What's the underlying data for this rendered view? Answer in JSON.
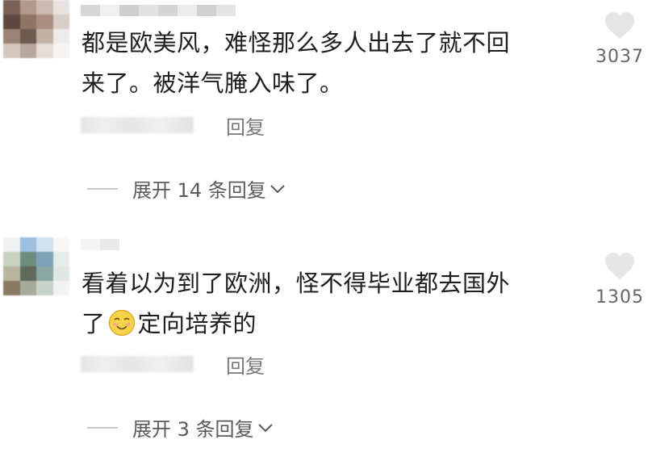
{
  "comments": [
    {
      "text_lines": [
        "都是欧美风，难怪那么多人出去了就不回",
        "来了。被洋气腌入味了。"
      ],
      "like_count": "3037",
      "reply_label": "回复",
      "expand_label": "展开 14 条回复"
    },
    {
      "text_line1": "看着以为到了欧洲，怪不得毕业都去国外",
      "text_line2_start": "了",
      "emoji": "smiley-emoji",
      "text_line2_end": "定向培养的",
      "like_count": "1305",
      "reply_label": "回复",
      "expand_label": "展开 3 条回复"
    }
  ],
  "icons": {
    "like": "heart-icon",
    "expand": "chevron-down-icon"
  },
  "colors": {
    "text": "#1e1e1e",
    "secondary": "#777777",
    "heart": "#e6e6e6"
  }
}
